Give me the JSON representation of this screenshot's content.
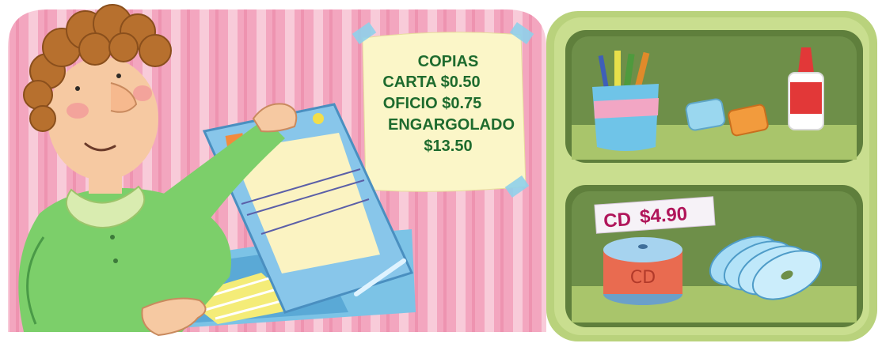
{
  "price_note": {
    "lines": [
      "COPIAS",
      "CARTA $0.50",
      "OFICIO $0.75",
      "ENGARGOLADO",
      "$13.50"
    ]
  },
  "cd_price_tag": {
    "item": "CD",
    "price": "$4.90"
  },
  "cd_spindle": {
    "label": "CD"
  },
  "colors": {
    "wall_pink": "#f3a6bf",
    "stripe_pink": "#f7c4d4",
    "shelf_green": "#b9d27c",
    "shelf_dark": "#5f7f3c",
    "note_yellow": "#fbf6c8",
    "price_green": "#1e6b2e",
    "tag_magenta": "#b0155a"
  },
  "icons": [
    "boy-figure",
    "photocopier",
    "pencil-cup",
    "eraser-blue",
    "eraser-orange",
    "glue-bottle",
    "cd-spindle",
    "cd-stack",
    "tape-icon"
  ]
}
